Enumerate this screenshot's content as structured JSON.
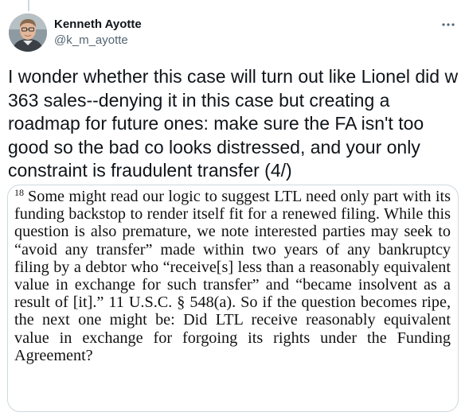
{
  "tweet": {
    "author": {
      "display_name": "Kenneth Ayotte",
      "handle": "@k_m_ayotte",
      "avatar_icon": "profile-photo"
    },
    "more_icon": "ellipsis-icon",
    "text": "I wonder whether this case will turn out like Lionel did w 363 sales--denying it in this case but creating a roadmap for future ones: make sure the FA isn't too good so the bad co looks distressed, and your only constraint is fraudulent transfer (4/)",
    "media": {
      "footnote_number": "18",
      "excerpt_text": "Some might read our logic to suggest LTL need only part with its funding backstop to render itself fit for a renewed filing.  While this question is also premature, we note interested parties may seek to “avoid any transfer” made within two years of any bankruptcy filing by a debtor who “receive[s] less than a reasonably equivalent value in exchange for such transfer” and “became insolvent as a result of [it].”  11 U.S.C. § 548(a).  So if the question becomes ripe, the next one might be: Did LTL receive reasonably equivalent value in exchange for forgoing its rights under the Funding Agreement?"
    }
  },
  "colors": {
    "text_primary": "#0f1419",
    "text_secondary": "#536471",
    "border": "#cfd9de"
  }
}
